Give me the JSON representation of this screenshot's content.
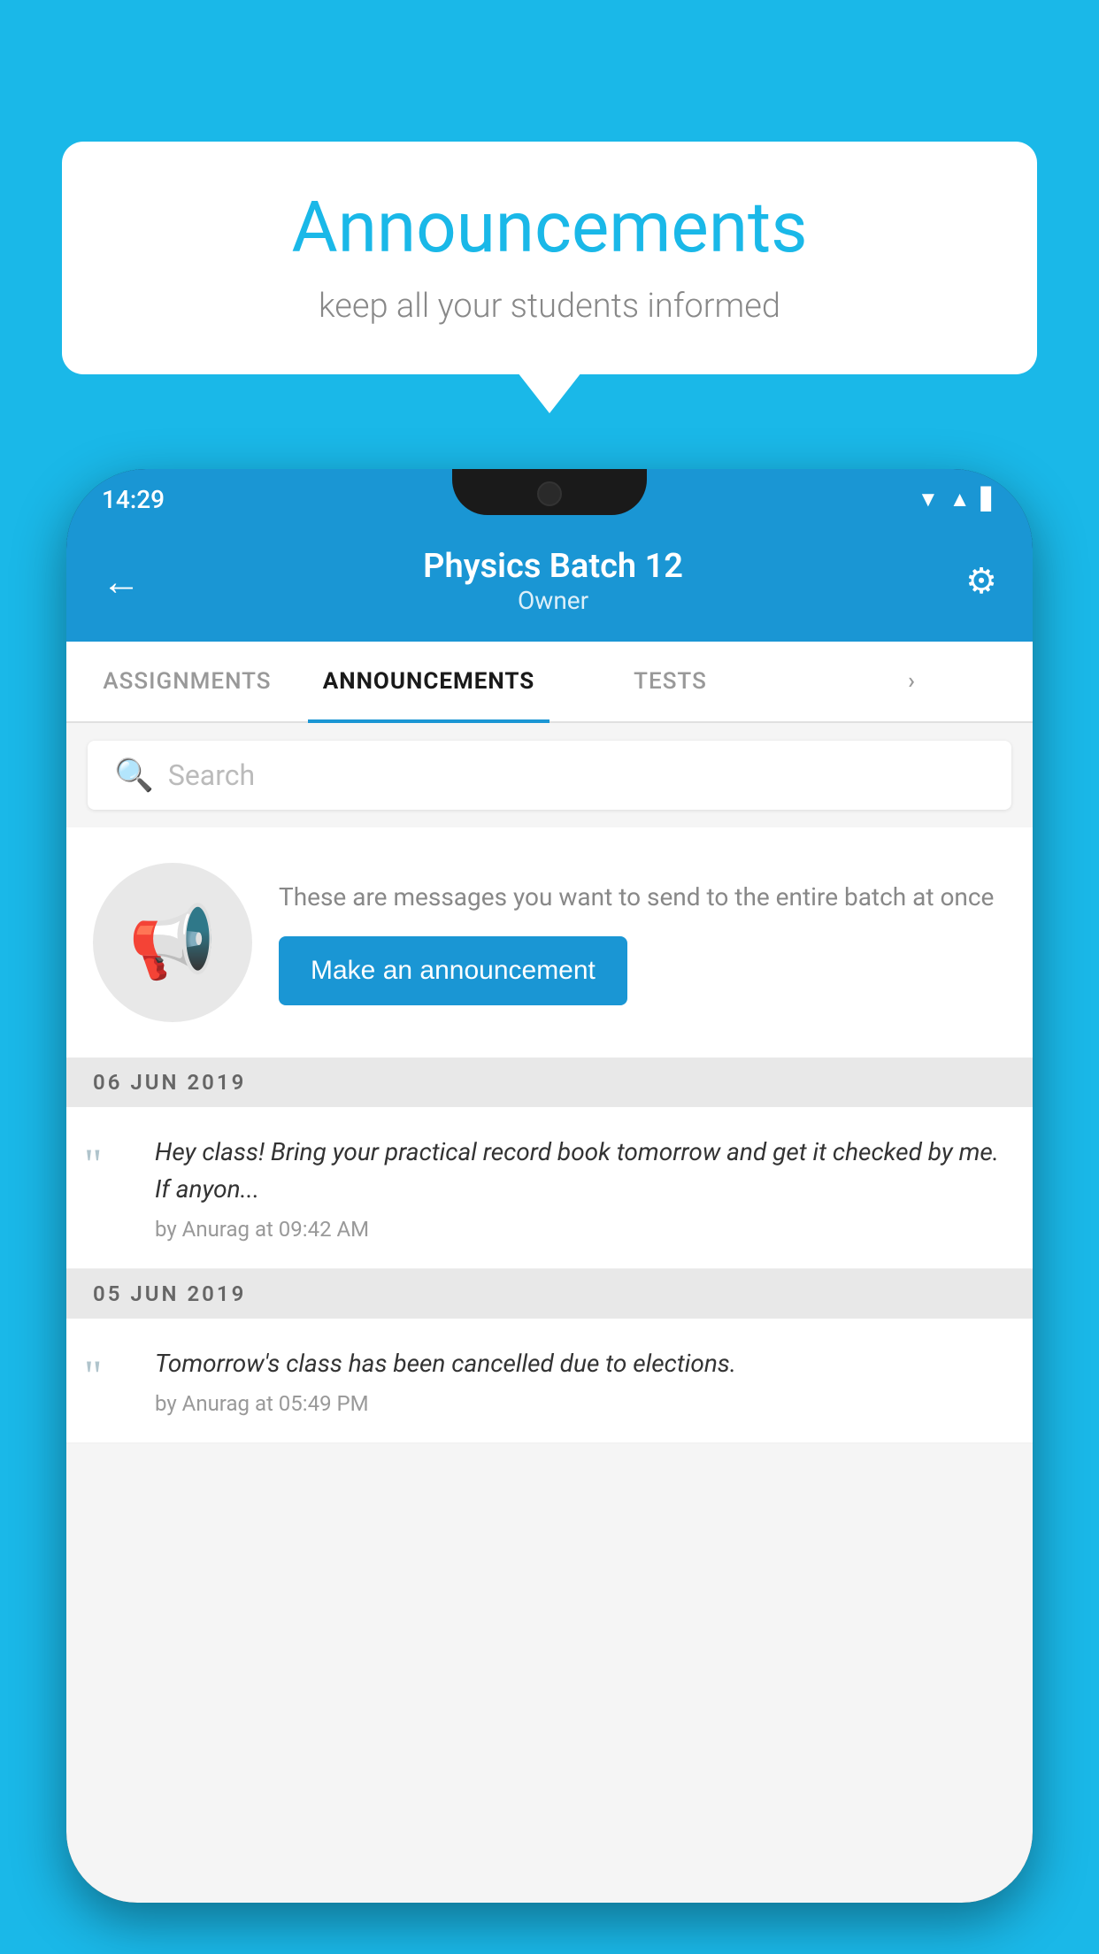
{
  "background": {
    "color": "#1ab8e8"
  },
  "speech_bubble": {
    "title": "Announcements",
    "subtitle": "keep all your students informed"
  },
  "status_bar": {
    "time": "14:29",
    "wifi_icon": "▲",
    "signal_icon": "▲",
    "battery_icon": "▋"
  },
  "header": {
    "back_icon": "←",
    "title": "Physics Batch 12",
    "subtitle": "Owner",
    "settings_icon": "⚙"
  },
  "tabs": [
    {
      "label": "ASSIGNMENTS",
      "active": false
    },
    {
      "label": "ANNOUNCEMENTS",
      "active": true
    },
    {
      "label": "TESTS",
      "active": false
    },
    {
      "label": "›",
      "active": false
    }
  ],
  "search": {
    "placeholder": "Search",
    "icon": "🔍"
  },
  "announcement_placeholder": {
    "description": "These are messages you want to send to the entire batch at once",
    "button_label": "Make an announcement"
  },
  "announcements": [
    {
      "date": "06  JUN  2019",
      "text": "Hey class! Bring your practical record book tomorrow and get it checked by me. If anyon...",
      "meta": "by Anurag at 09:42 AM"
    },
    {
      "date": "05  JUN  2019",
      "text": "Tomorrow's class has been cancelled due to elections.",
      "meta": "by Anurag at 05:49 PM"
    }
  ]
}
